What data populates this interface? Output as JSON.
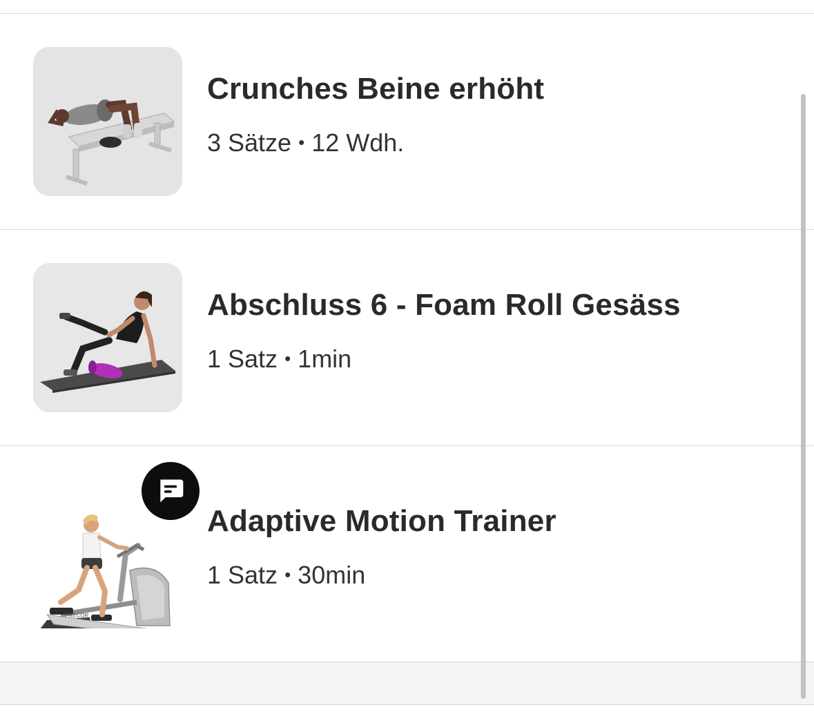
{
  "exercises": [
    {
      "title": "Crunches Beine erhöht",
      "sets": "3 Sätze",
      "separator": "•",
      "detail": "12 Wdh.",
      "image_icon": "person-crunch-on-bench-icon"
    },
    {
      "title": "Abschluss 6 - Foam Roll Gesäss",
      "sets": "1 Satz",
      "separator": "•",
      "detail": "1min",
      "image_icon": "person-foam-roller-icon"
    },
    {
      "title": "Adaptive Motion Trainer",
      "sets": "1 Satz",
      "separator": "•",
      "detail": "30min",
      "image_icon": "elliptical-trainer-icon",
      "badge_icon": "chat-message-icon"
    }
  ],
  "colors": {
    "badge": "#0d0d0d",
    "foam_roller": "#b030b8",
    "thumb_bg": "#e4e4e4"
  }
}
